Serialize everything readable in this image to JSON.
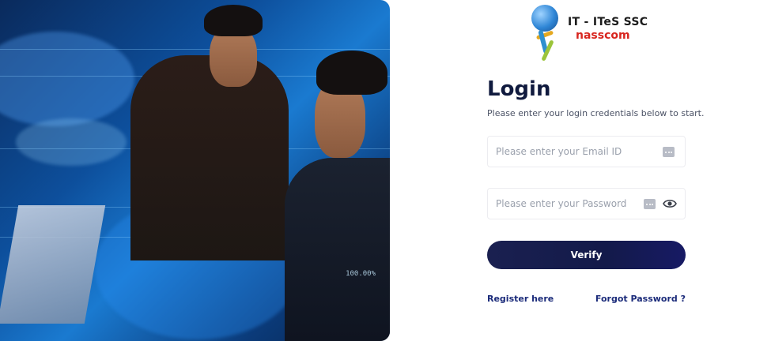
{
  "hero": {
    "overlay_readout": "100.00%"
  },
  "logo": {
    "title": "IT - ITeS SSC",
    "subtitle": "nasscom"
  },
  "login": {
    "title": "Login",
    "subtitle": "Please enter your login credentials below to start.",
    "email": {
      "value": "",
      "placeholder": "Please enter your Email ID",
      "icon": "password-manager-icon"
    },
    "password": {
      "value": "",
      "placeholder": "Please enter your Password",
      "icon": "password-manager-icon",
      "toggle_icon": "eye-icon"
    },
    "verify_label": "Verify",
    "register_label": "Register here",
    "forgot_label": "Forgot Password ?"
  },
  "colors": {
    "primary_button": "#131a4a",
    "link": "#1b2b7a",
    "brand_red": "#d8261f"
  }
}
